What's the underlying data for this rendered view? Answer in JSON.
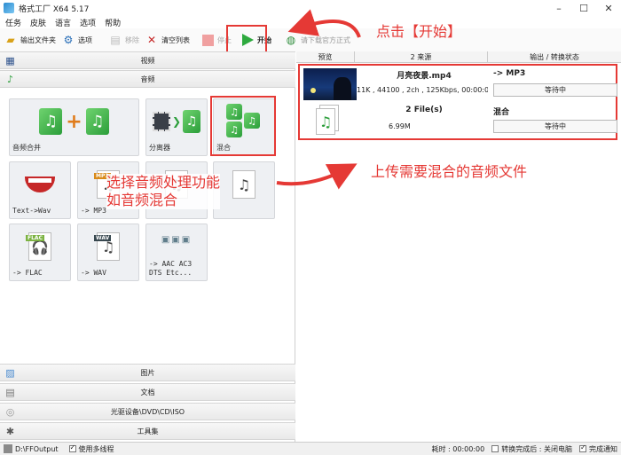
{
  "window": {
    "title": "格式工厂 X64 5.17",
    "min": "–",
    "max": "☐",
    "close": "✕"
  },
  "menu": [
    "任务",
    "皮肤",
    "语言",
    "选项",
    "帮助"
  ],
  "toolbar": {
    "output_folder": "输出文件夹",
    "options": "选项",
    "remove": "移除",
    "clear_list": "清空列表",
    "stop": "停止",
    "start": "开始",
    "download": "请下载官方正式"
  },
  "categories": {
    "video": "视频",
    "audio": "音频",
    "image": "图片",
    "document": "文档",
    "disc": "光驱设备\\DVD\\CD\\ISO",
    "tools": "工具集"
  },
  "audio_tiles": [
    {
      "label": "音频合并"
    },
    {
      "label": "分离器"
    },
    {
      "label": "混合"
    },
    {
      "label": "Text->Wav"
    },
    {
      "label": "-> MP3",
      "badge": "MP3"
    },
    {
      "label": ""
    },
    {
      "label": ""
    },
    {
      "label": "-> FLAC",
      "badge": "FLAC"
    },
    {
      "label": "-> WAV",
      "badge": "WAV"
    },
    {
      "label": "-> AAC AC3\nDTS Etc..."
    }
  ],
  "list": {
    "headers": [
      "预览",
      "2 来源",
      "输出 / 转换状态"
    ],
    "rows": [
      {
        "name": "月亮夜景.mp4",
        "info": "11K , 44100 , 2ch , 125Kbps, 00:00:0",
        "output": "-> MP3",
        "status": "等待中"
      },
      {
        "name": "2 File(s)",
        "info": "6.99M",
        "output": "混合",
        "status": "等待中"
      }
    ]
  },
  "annotations": {
    "click_start": "点击【开始】",
    "select_function": "选择音频处理功能\n如音频混合",
    "upload_files": "上传需要混合的音频文件"
  },
  "statusbar": {
    "output_path": "D:\\FFOutput",
    "multithread": "使用多线程",
    "elapsed": "耗时 : 00:00:00",
    "after_convert": "转换完成后 : 关闭电脑",
    "notify": "完成通知"
  },
  "colors": {
    "annotation_red": "#e53935",
    "start_green": "#2eaa3f"
  }
}
